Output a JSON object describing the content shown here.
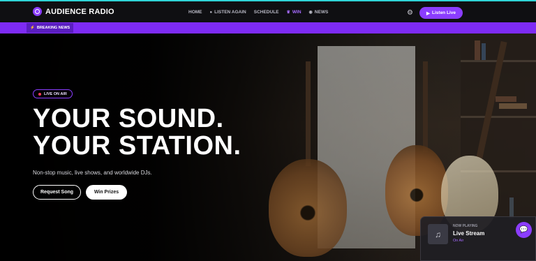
{
  "brand": {
    "name": "AUDIENCE RADIO"
  },
  "nav": {
    "items": [
      {
        "label": "HOME",
        "icon": ""
      },
      {
        "label": "LISTEN AGAIN",
        "icon": "pin-icon"
      },
      {
        "label": "SCHEDULE",
        "icon": ""
      },
      {
        "label": "WIN",
        "icon": "trophy-icon"
      },
      {
        "label": "NEWS",
        "icon": "globe-icon"
      }
    ],
    "listen_live": "Listen Live"
  },
  "breaking": {
    "label": "BREAKING NEWS"
  },
  "hero": {
    "badge": "LIVE ON AIR",
    "headline_line1": "YOUR SOUND.",
    "headline_line2": "YOUR STATION.",
    "subtitle": "Non-stop music, live shows, and worldwide DJs.",
    "request_button": "Request Song",
    "prizes_button": "Win Prizes"
  },
  "now_playing": {
    "label": "NOW PLAYING",
    "title": "Live Stream",
    "status": "On Air"
  },
  "colors": {
    "accent": "#8b3dff",
    "breaking_bar": "#7e2bf5",
    "live_dot": "#ff3b5c",
    "top_border": "#2fd3d6"
  }
}
